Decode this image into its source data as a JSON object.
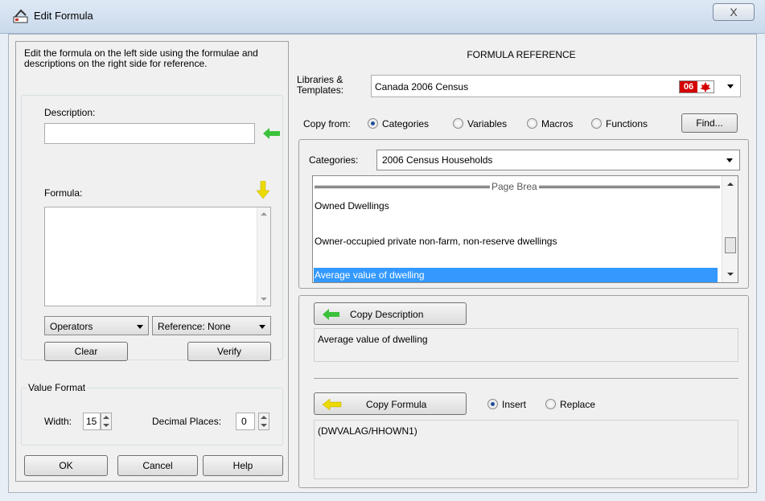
{
  "window": {
    "title": "Edit Formula",
    "close_glyph": "X"
  },
  "left": {
    "instructions": "Edit the formula on the left side using the formulae and descriptions on the right side for reference.",
    "description_label": "Description:",
    "description_value": "",
    "formula_label": "Formula:",
    "formula_value": "",
    "operators_label": "Operators",
    "reference_label": "Reference: None",
    "clear_label": "Clear",
    "verify_label": "Verify",
    "value_format": {
      "legend": "Value Format",
      "width_label": "Width:",
      "width_value": "15",
      "decimal_label": "Decimal Places:",
      "decimal_value": "0"
    },
    "ok_label": "OK",
    "cancel_label": "Cancel",
    "help_label": "Help"
  },
  "right": {
    "heading": "FORMULA REFERENCE",
    "libraries_label": "Libraries & Templates:",
    "library_value": "Canada 2006 Census",
    "library_badge": "06",
    "copy_from_label": "Copy from:",
    "copy_options": [
      "Categories",
      "Variables",
      "Macros",
      "Functions"
    ],
    "copy_selected": "Categories",
    "find_label": "Find...",
    "categories_label": "Categories:",
    "categories_value": "2006 Census Households",
    "list": {
      "page_break": "Page Brea",
      "items": [
        "Owned Dwellings",
        "Owner-occupied private non-farm, non-reserve dwellings",
        "Average value of dwelling"
      ],
      "selected": "Average value of dwelling"
    },
    "copy_description_label": "Copy Description",
    "description_output": "Average value of dwelling",
    "copy_formula_label": "Copy Formula",
    "insert_label": "Insert",
    "replace_label": "Replace",
    "insert_mode": "Insert",
    "formula_output": "(DWVALAG/HHOWN1)"
  },
  "colors": {
    "selection": "#3399ff",
    "green_arrow": "#2ecc40",
    "yellow_arrow": "#e6d000",
    "badge_red": "#d40000"
  }
}
